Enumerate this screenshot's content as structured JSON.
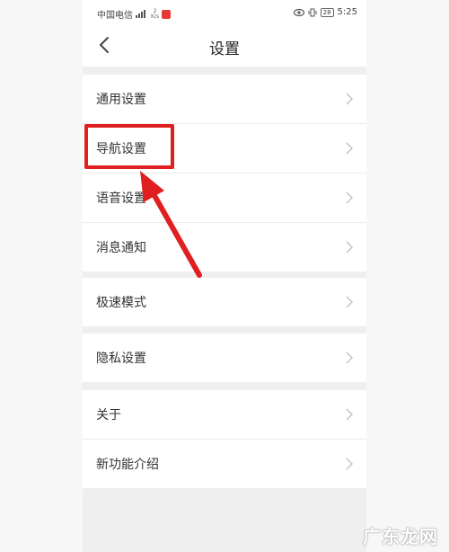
{
  "status_bar": {
    "carrier": "中国电信",
    "signal_label": "4G",
    "speed_value": "2",
    "speed_unit": "K/s",
    "battery": "28",
    "time": "5:25"
  },
  "nav": {
    "back_icon": "chevron-left-icon",
    "title": "设置"
  },
  "groups": [
    {
      "items": [
        {
          "label": "通用设置"
        },
        {
          "label": "导航设置"
        },
        {
          "label": "语音设置"
        },
        {
          "label": "消息通知"
        }
      ]
    },
    {
      "items": [
        {
          "label": "极速模式"
        }
      ]
    },
    {
      "items": [
        {
          "label": "隐私设置"
        }
      ]
    },
    {
      "items": [
        {
          "label": "关于"
        },
        {
          "label": "新功能介绍"
        }
      ]
    }
  ],
  "annotation": {
    "color": "#e02020"
  },
  "watermark": "广东龙网"
}
